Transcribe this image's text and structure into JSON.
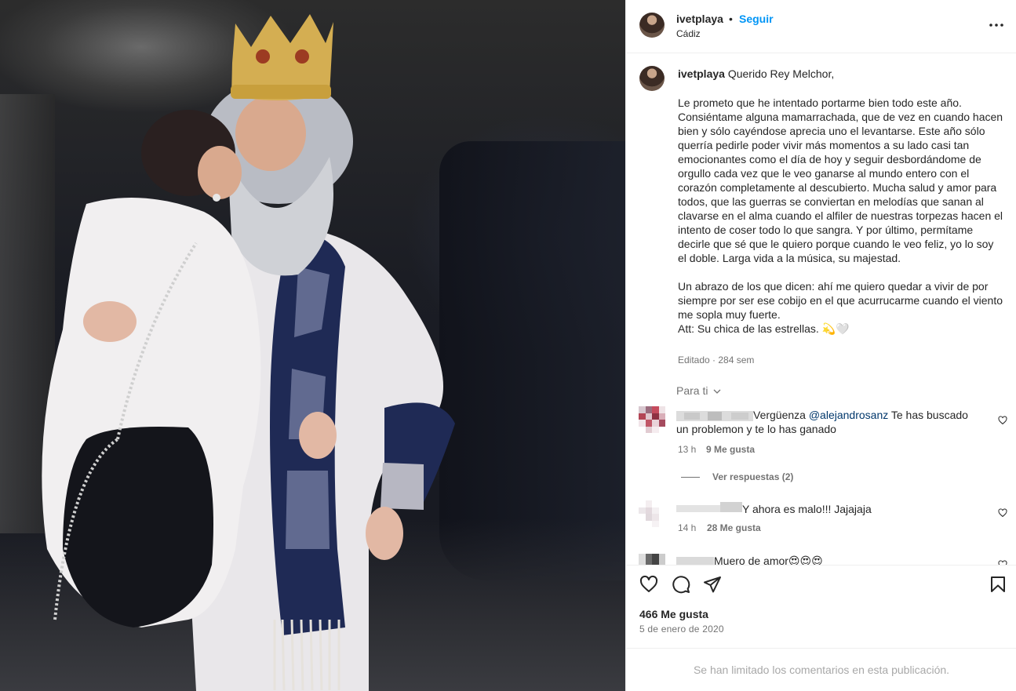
{
  "header": {
    "username": "ivetplaya",
    "separator": "•",
    "follow_label": "Seguir",
    "location": "Cádiz"
  },
  "caption": {
    "username": "ivetplaya",
    "greeting": "Querido Rey Melchor,",
    "body": "Le prometo que he intentado portarme bien todo este año. Consiéntame alguna mamarrachada, que de vez en cuando hacen bien y sólo cayéndose aprecia uno el levantarse. Este año sólo querría pedirle poder vivir más momentos a su lado casi tan emocionantes como el día de hoy y seguir desbordándome de orgullo cada vez que le veo ganarse al mundo entero con el corazón completamente al descubierto. Mucha salud y amor para todos, que las guerras se conviertan en melodías que sanan al clavarse en el alma cuando el alfiler de nuestras torpezas hacen el intento de coser todo lo que sangra. Y por último, permítame decirle que sé que le quiero porque cuando le veo feliz, yo lo soy el doble. Larga vida a la música, su majestad.\n\nUn abrazo de los que dicen: ahí me quiero quedar a vivir de por siempre por ser ese cobijo en el que acurrucarme cuando el viento me sopla muy fuerte.\nAtt: Su chica de las estrellas. 💫🤍",
    "meta": "Editado · 284 sem"
  },
  "for_you_label": "Para ti",
  "comments": [
    {
      "text_before": "Vergüenza ",
      "mention": "@alejandrosanz",
      "text_after": " Te has buscado un problemon y te lo has ganado",
      "time": "13 h",
      "likes": "9 Me gusta"
    },
    {
      "text": "Y ahora es malo!!! Jajajaja",
      "time": "14 h",
      "likes": "28 Me gusta"
    },
    {
      "text": "Muero de amor😍😍😍"
    }
  ],
  "view_replies_label": "Ver respuestas (2)",
  "actions": {
    "like_count": "466 Me gusta",
    "date": "5 de enero de 2020"
  },
  "comments_limited_notice": "Se han limitado los comentarios en esta publicación.",
  "colors": {
    "accent": "#0095f6",
    "secondary_text": "#737373",
    "mention": "#00376b"
  }
}
